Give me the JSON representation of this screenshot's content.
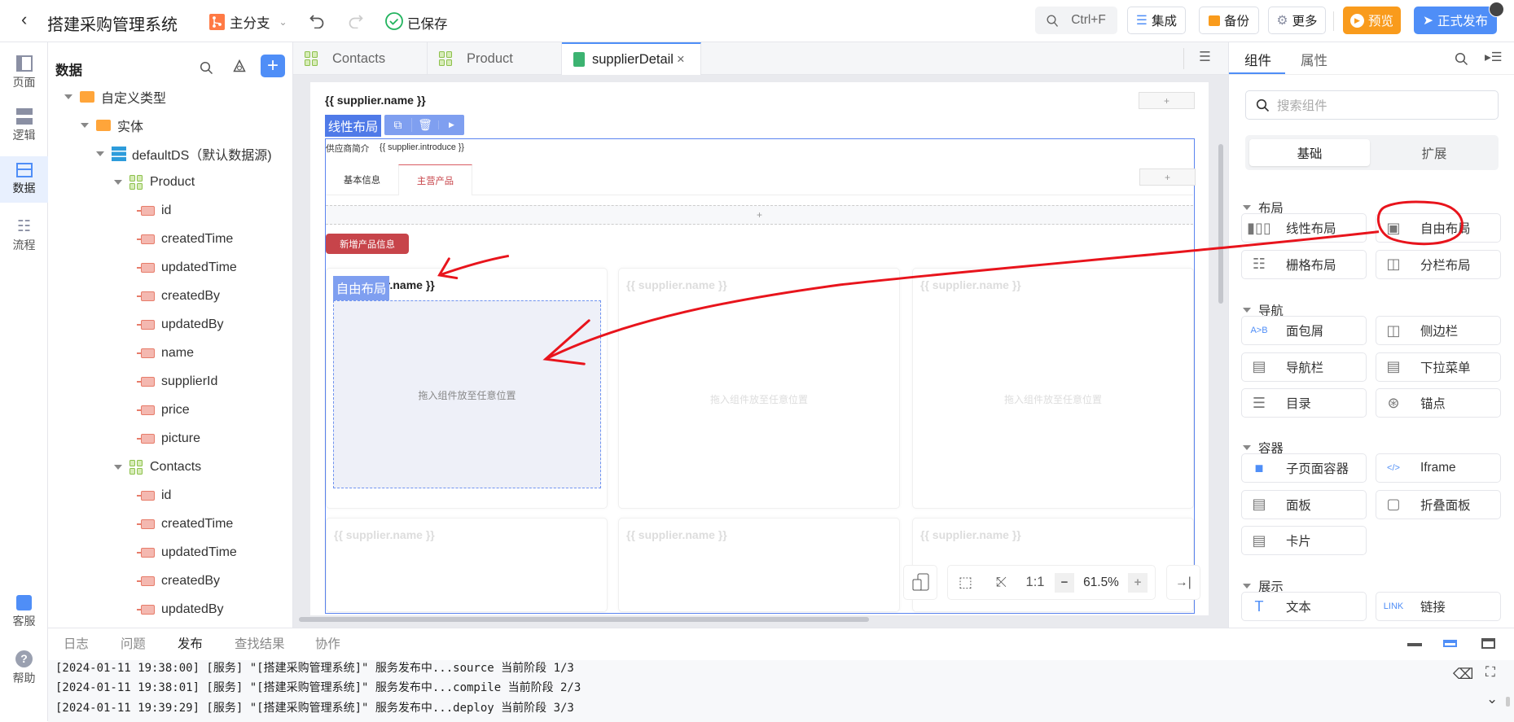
{
  "app": {
    "title": "搭建采购管理系统",
    "branch": "主分支",
    "saved_status": "已保存"
  },
  "toolbar": {
    "search_shortcut": "Ctrl+F",
    "integrate": "集成",
    "backup": "备份",
    "more": "更多",
    "preview": "预览",
    "publish": "正式发布"
  },
  "colors": {
    "accent": "#4f8ef7",
    "preview": "#f99b1c",
    "branch": "#ff7a45",
    "saved": "#22b35e",
    "danger_button": "#c7444a",
    "annotation": "#e8141c"
  },
  "rail": {
    "items": [
      {
        "label": "页面",
        "icon": "page-icon"
      },
      {
        "label": "逻辑",
        "icon": "logic-icon"
      },
      {
        "label": "数据",
        "icon": "data-icon",
        "active": true
      },
      {
        "label": "流程",
        "icon": "flow-icon"
      }
    ],
    "bottom": [
      {
        "label": "客服",
        "icon": "support-icon"
      },
      {
        "label": "帮助",
        "icon": "help-icon"
      }
    ]
  },
  "tree": {
    "title": "数据",
    "nodes": [
      {
        "label": "自定义类型",
        "type": "folder",
        "level": 0
      },
      {
        "label": "实体",
        "type": "folder",
        "level": 1
      },
      {
        "label": "defaultDS（默认数据源)",
        "type": "datasource",
        "level": 2
      },
      {
        "label": "Product",
        "type": "entity",
        "level": 3
      },
      {
        "label": "id",
        "type": "field",
        "level": 4
      },
      {
        "label": "createdTime",
        "type": "field",
        "level": 4
      },
      {
        "label": "updatedTime",
        "type": "field",
        "level": 4
      },
      {
        "label": "createdBy",
        "type": "field",
        "level": 4
      },
      {
        "label": "updatedBy",
        "type": "field",
        "level": 4
      },
      {
        "label": "name",
        "type": "field",
        "level": 4
      },
      {
        "label": "supplierId",
        "type": "field",
        "level": 4
      },
      {
        "label": "price",
        "type": "field",
        "level": 4
      },
      {
        "label": "picture",
        "type": "field",
        "level": 4
      },
      {
        "label": "Contacts",
        "type": "entity",
        "level": 3
      },
      {
        "label": "id",
        "type": "field",
        "level": 4
      },
      {
        "label": "createdTime",
        "type": "field",
        "level": 4
      },
      {
        "label": "updatedTime",
        "type": "field",
        "level": 4
      },
      {
        "label": "createdBy",
        "type": "field",
        "level": 4
      },
      {
        "label": "updatedBy",
        "type": "field",
        "level": 4
      }
    ]
  },
  "editor_tabs": [
    {
      "label": "Contacts"
    },
    {
      "label": "Product"
    },
    {
      "label": "supplierDetail",
      "active": true
    }
  ],
  "canvas": {
    "heading": "{{ supplier.name }}",
    "plus": "+",
    "linear_tag": "线性布局",
    "intro_label": "供应商简介",
    "intro_value": "{{ supplier.introduce }}",
    "tabs": [
      {
        "label": "基本信息"
      },
      {
        "label": "主营产品",
        "active": true
      }
    ],
    "add_button": "新增产品信息",
    "free_tag": "自由布局",
    "card_title": "{{ supplier.name }}",
    "drop_hint": "拖入组件放至任意位置",
    "zoom": {
      "ratio": "1:1",
      "level": "61.5%"
    }
  },
  "right_panel": {
    "tabs": [
      {
        "label": "组件",
        "active": true
      },
      {
        "label": "属性"
      }
    ],
    "search_placeholder": "搜索组件",
    "segments": [
      {
        "label": "基础",
        "active": true
      },
      {
        "label": "扩展"
      }
    ],
    "sections": [
      {
        "title": "布局",
        "items": [
          {
            "label": "线性布局",
            "icon": "linear-layout-icon"
          },
          {
            "label": "自由布局",
            "icon": "free-layout-icon"
          },
          {
            "label": "栅格布局",
            "icon": "grid-layout-icon"
          },
          {
            "label": "分栏布局",
            "icon": "column-layout-icon"
          }
        ]
      },
      {
        "title": "导航",
        "items": [
          {
            "label": "面包屑",
            "icon": "breadcrumb-icon"
          },
          {
            "label": "侧边栏",
            "icon": "sidebar-icon"
          },
          {
            "label": "导航栏",
            "icon": "navbar-icon"
          },
          {
            "label": "下拉菜单",
            "icon": "dropdown-icon"
          },
          {
            "label": "目录",
            "icon": "toc-icon"
          },
          {
            "label": "锚点",
            "icon": "anchor-icon"
          }
        ]
      },
      {
        "title": "容器",
        "items": [
          {
            "label": "子页面容器",
            "icon": "subpage-icon"
          },
          {
            "label": "Iframe",
            "icon": "iframe-icon"
          },
          {
            "label": "面板",
            "icon": "panel-icon"
          },
          {
            "label": "折叠面板",
            "icon": "collapse-icon"
          },
          {
            "label": "卡片",
            "icon": "card-icon"
          }
        ]
      },
      {
        "title": "展示",
        "items": [
          {
            "label": "文本",
            "icon": "text-icon"
          },
          {
            "label": "链接",
            "icon": "link-icon"
          }
        ]
      }
    ]
  },
  "bottom": {
    "tabs": [
      {
        "label": "日志"
      },
      {
        "label": "问题"
      },
      {
        "label": "发布",
        "active": true
      },
      {
        "label": "查找结果"
      },
      {
        "label": "协作"
      }
    ],
    "logs": [
      "[2024-01-11 19:38:00] [服务] \"[搭建采购管理系统]\" 服务发布中...source 当前阶段 1/3",
      "[2024-01-11 19:38:01] [服务] \"[搭建采购管理系统]\" 服务发布中...compile 当前阶段 2/3",
      "[2024-01-11 19:39:29] [服务] \"[搭建采购管理系统]\" 服务发布中...deploy 当前阶段 3/3"
    ]
  }
}
